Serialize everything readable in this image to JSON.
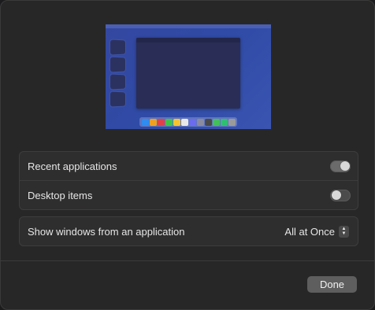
{
  "preview": {
    "dock_colors": [
      "#2f8cf0",
      "#f0a020",
      "#e0404a",
      "#3fc44a",
      "#f6c431",
      "#e8e8e8",
      "#6b6bf0",
      "#8a8aa0",
      "#4a4a4a",
      "#42c05a",
      "#2fbf72",
      "#9a9a9a"
    ]
  },
  "options": {
    "recent_applications": {
      "label": "Recent applications",
      "state": "on"
    },
    "desktop_items": {
      "label": "Desktop items",
      "state": "off"
    }
  },
  "show_windows": {
    "label": "Show windows from an application",
    "value": "All at Once",
    "icon": "up-down-chevron-icon"
  },
  "footer": {
    "done_label": "Done"
  }
}
